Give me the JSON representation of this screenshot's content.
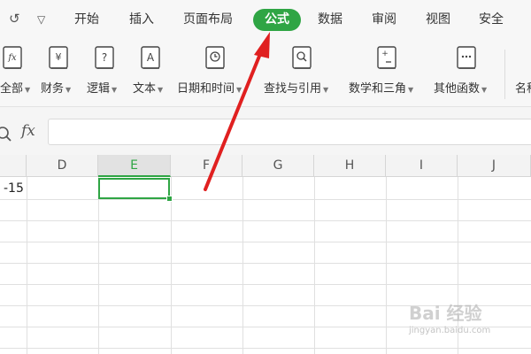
{
  "quick_access": {
    "undo_icon": "undo-icon",
    "dropdown_icon": "chevron-down-icon"
  },
  "menu": {
    "items": [
      "开始",
      "插入",
      "页面布局",
      "公式",
      "数据",
      "审阅",
      "视图",
      "安全"
    ],
    "active": "公式",
    "active_color": "#2fa544"
  },
  "ribbon": {
    "buttons": [
      {
        "label": "全部",
        "icon": "fx-book-icon"
      },
      {
        "label": "财务",
        "icon": "yen-book-icon"
      },
      {
        "label": "逻辑",
        "icon": "question-book-icon"
      },
      {
        "label": "文本",
        "icon": "letter-a-book-icon"
      },
      {
        "label": "日期和时间",
        "icon": "clock-book-icon"
      },
      {
        "label": "查找与引用",
        "icon": "magnifier-book-icon"
      },
      {
        "label": "数学和三角",
        "icon": "plus-minus-book-icon"
      },
      {
        "label": "其他函数",
        "icon": "ellipsis-book-icon"
      },
      {
        "label": "名称",
        "icon": ""
      }
    ]
  },
  "formula_bar": {
    "zoom_icon": "zoom-icon",
    "fx_label": "fx",
    "value": ""
  },
  "sheet": {
    "columns": [
      "D",
      "E",
      "F",
      "G",
      "H",
      "I",
      "J"
    ],
    "selected_column": "E",
    "cell_partial_text": "-15"
  },
  "watermark": {
    "text": "Bai 经验",
    "url": "jingyan.baidu.com"
  }
}
